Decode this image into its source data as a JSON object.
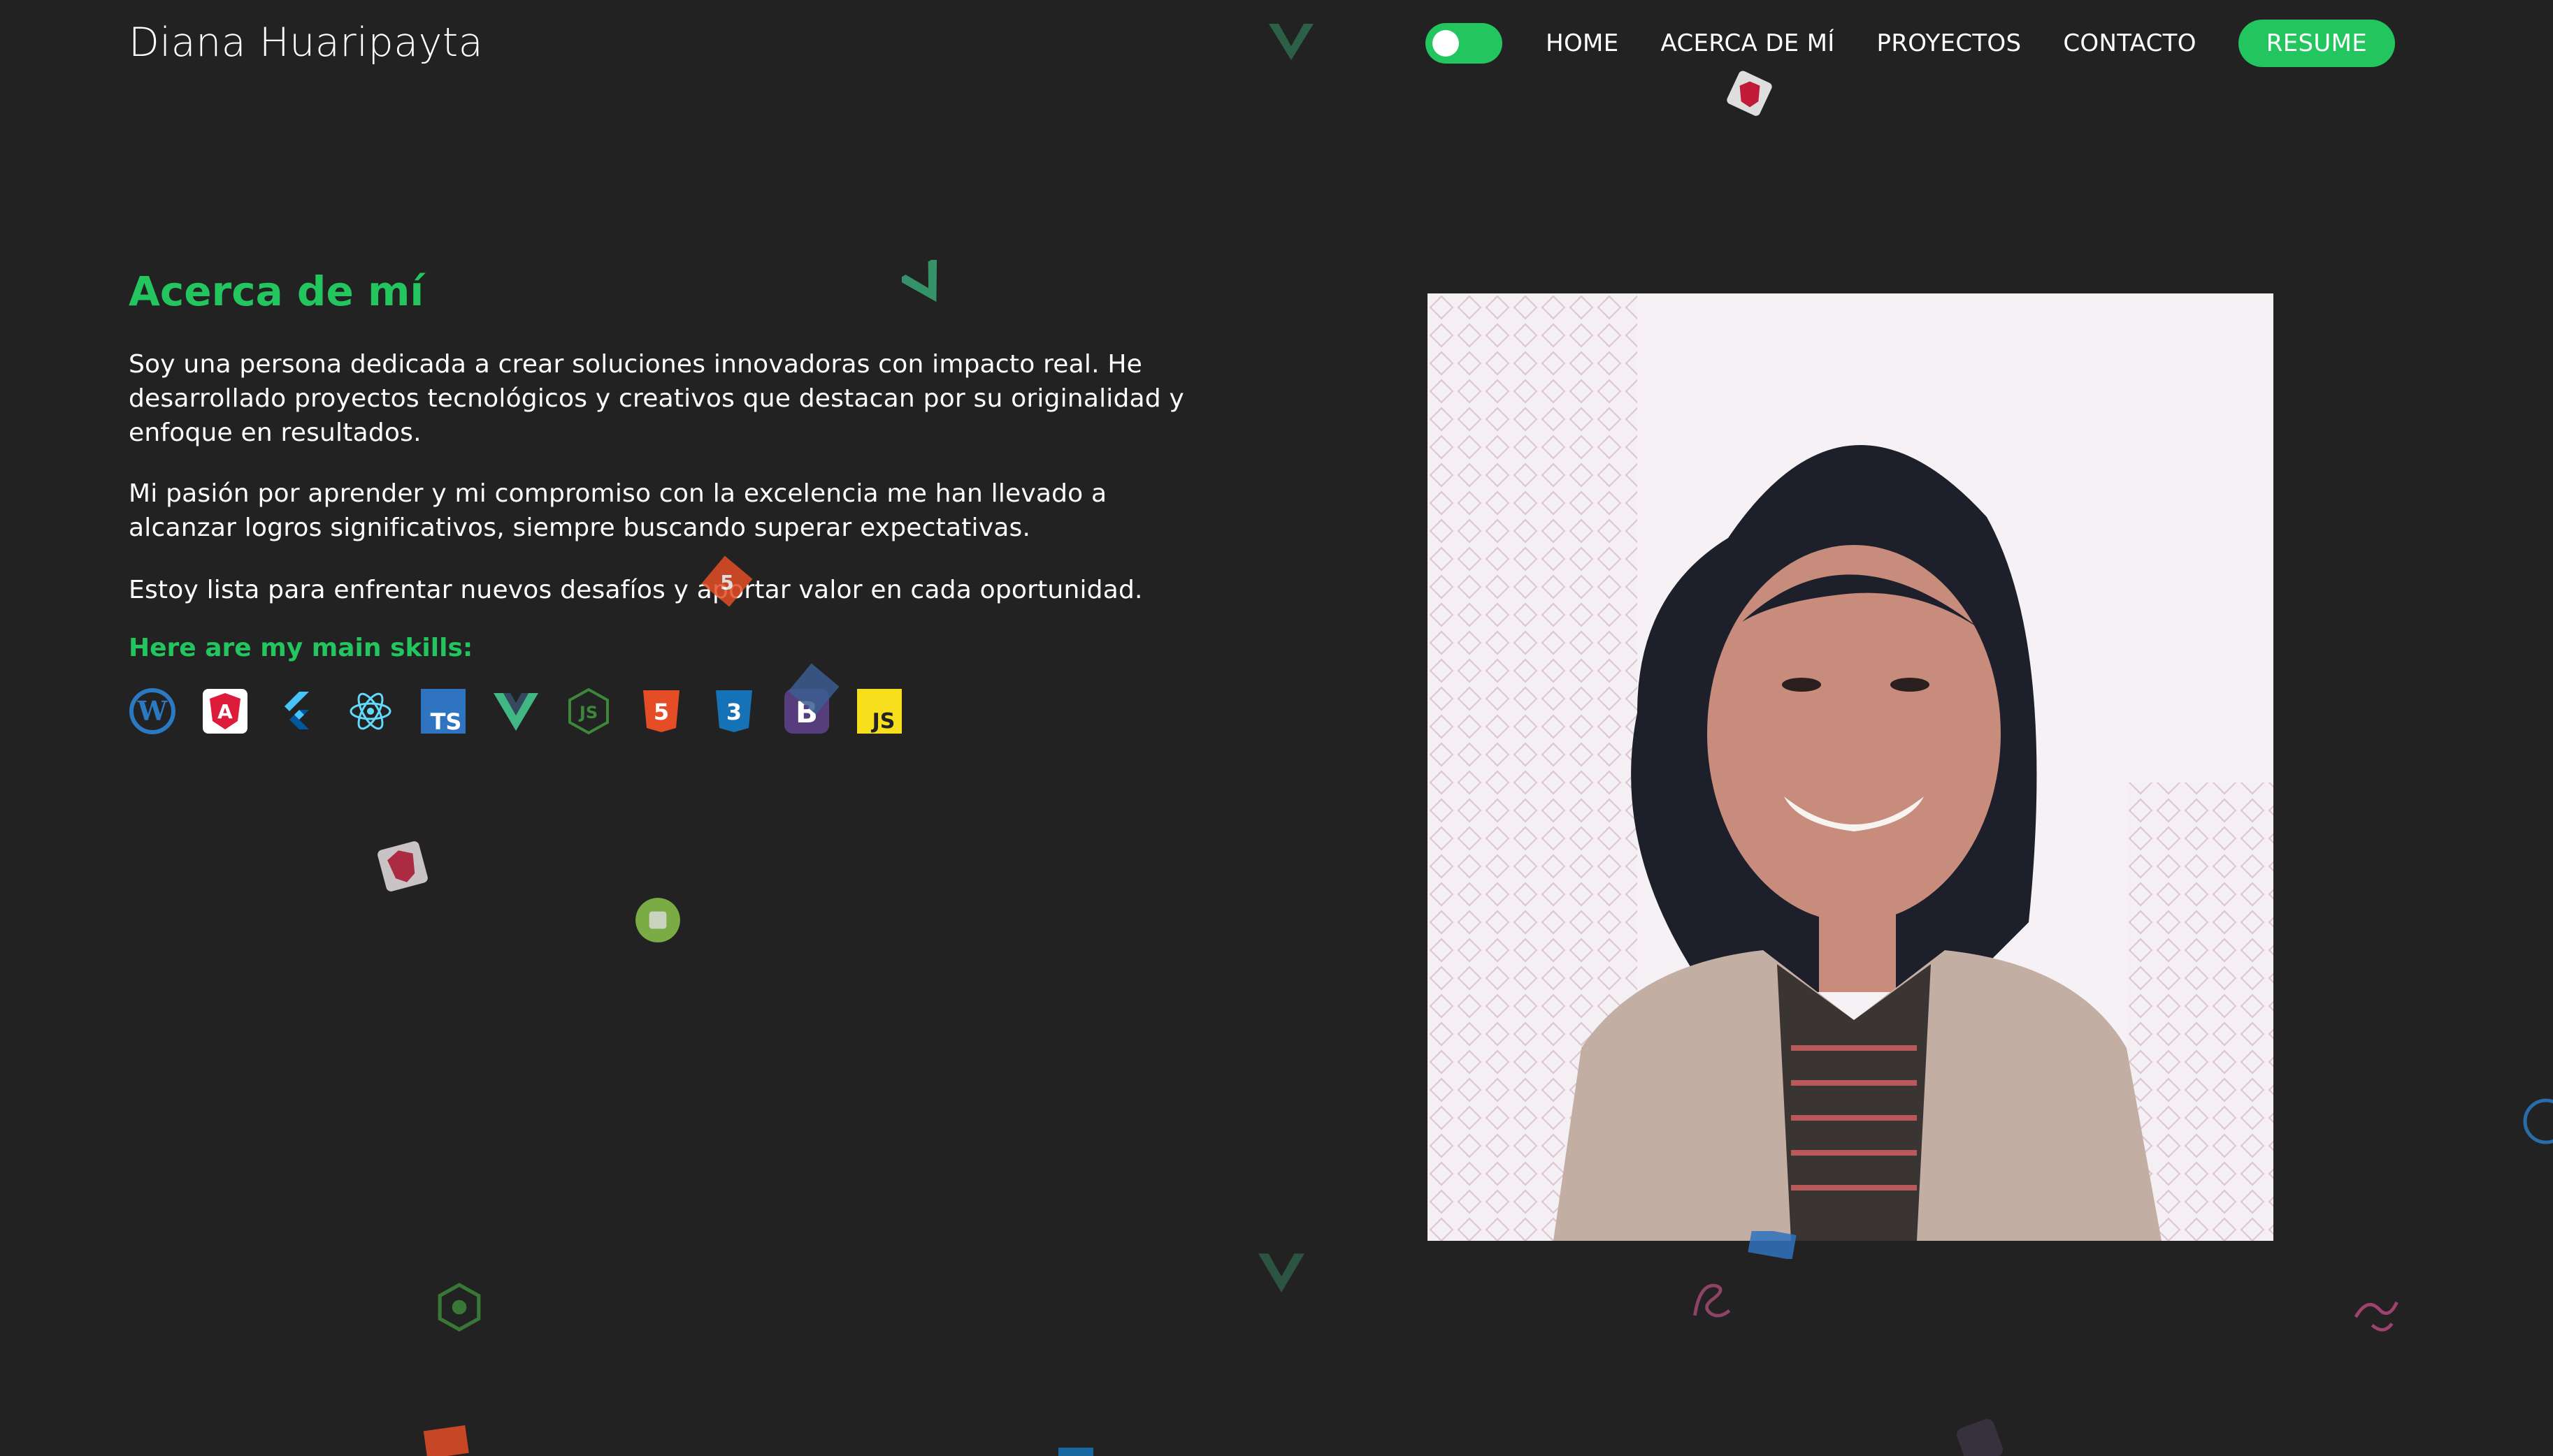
{
  "header": {
    "brand": "Diana Huaripayta",
    "nav": [
      "HOME",
      "ACERCA DE MÍ",
      "PROYECTOS",
      "CONTACTO"
    ],
    "resume_label": "RESUME",
    "theme_toggle": "on"
  },
  "about": {
    "title": "Acerca de mí",
    "paragraphs": [
      "Soy una persona dedicada a crear soluciones innovadoras con impacto real. He desarrollado proyectos tecnológicos y creativos que destacan por su originalidad y enfoque en resultados.",
      "Mi pasión por aprender y mi compromiso con la excelencia me han llevado a alcanzar logros significativos, siempre buscando superar expectativas.",
      "Estoy lista para enfrentar nuevos desafíos y aportar valor en cada oportunidad."
    ],
    "skills_title": "Here are my main skills:",
    "skills": [
      "wordpress-icon",
      "angular-icon",
      "flutter-icon",
      "react-icon",
      "typescript-icon",
      "vue-icon",
      "nodejs-icon",
      "html5-icon",
      "css3-icon",
      "bootstrap-icon",
      "javascript-icon"
    ]
  },
  "colors": {
    "background": "#222222",
    "accent": "#22c55e",
    "text": "#ffffff"
  }
}
